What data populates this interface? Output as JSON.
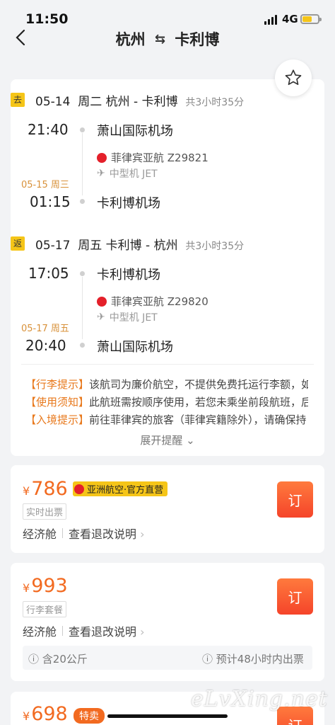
{
  "status": {
    "time": "11:50",
    "network": "4G"
  },
  "header": {
    "from": "杭州",
    "swap_glyph": "⇆",
    "to": "卡利博"
  },
  "outbound": {
    "tag": "去",
    "date": "05-14",
    "weekday": "周二",
    "route": "杭州 - 卡利博",
    "duration": "共3小时35分",
    "dep_time": "21:40",
    "dep_airport": "萧山国际机场",
    "airline": "菲律宾亚航 Z29821",
    "aircraft": "中型机 JET",
    "arr_date_note": "05-15 周三",
    "arr_time": "01:15",
    "arr_airport": "卡利博机场"
  },
  "inbound": {
    "tag": "返",
    "date": "05-17",
    "weekday": "周五",
    "route": "卡利博 - 杭州",
    "duration": "共3小时35分",
    "dep_time": "17:05",
    "dep_airport": "卡利博机场",
    "airline": "菲律宾亚航 Z29820",
    "aircraft": "中型机 JET",
    "arr_date_note": "05-17 周五",
    "arr_time": "20:40",
    "arr_airport": "萧山国际机场"
  },
  "tips": [
    {
      "label": "【行李提示】",
      "text": "该航司为廉价航空，不提供免费托运行李额，如"
    },
    {
      "label": "【使用须知】",
      "text": "此航班需按顺序使用，若您未乘坐前段航班，后"
    },
    {
      "label": "【入境提示】",
      "text": "前往菲律宾的旅客（菲律宾籍除外），请确保持"
    }
  ],
  "expand_label": "展开提醒",
  "offers": [
    {
      "yen": "¥",
      "price": "786",
      "badge": "亚洲航空·官方直营",
      "tag": "实时出票",
      "cabin": "经济舱",
      "refund": "查看退改说明",
      "book": "订"
    },
    {
      "yen": "¥",
      "price": "993",
      "tag": "行李套餐",
      "cabin": "经济舱",
      "refund": "查看退改说明",
      "book": "订",
      "baggage": "含20公斤",
      "ticketing": "预计48小时内出票"
    },
    {
      "yen": "¥",
      "price": "698",
      "badge": "特卖",
      "book": "订"
    }
  ],
  "watermark": "eLvXing.net",
  "colors": {
    "accent": "#f26a20",
    "tag_yellow": "#f5c518",
    "page_bg": "#f2f3f5"
  }
}
